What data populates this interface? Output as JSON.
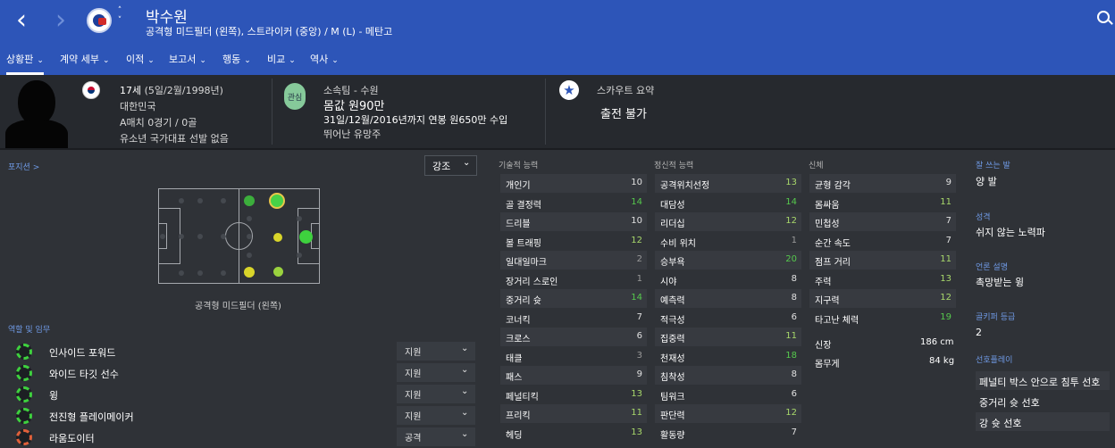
{
  "header": {
    "player_name": "박수원",
    "subtitle": "공격형 미드필더 (왼쪽), 스트라이커 (중앙) / M (L) - 메탄고"
  },
  "tabs": [
    {
      "label": "상황판"
    },
    {
      "label": "계약 세부"
    },
    {
      "label": "이적"
    },
    {
      "label": "보고서"
    },
    {
      "label": "행동"
    },
    {
      "label": "비교"
    },
    {
      "label": "역사"
    }
  ],
  "info": {
    "age": "17세",
    "dob": "(5일/2월/1998년)",
    "nation": "대한민국",
    "caps": "A매치 0경기 / 0골",
    "youth": "유소년 국가대표 선발 없음"
  },
  "club": {
    "badge": "관심",
    "team": "소속팀 - 수원",
    "value": "몸값 원90만",
    "contract": "31일/12월/2016년까지 연봉 원650만 수입",
    "potential": "뛰어난 유망주"
  },
  "scout": {
    "title": "스카우트 요약",
    "value": "출전 불가"
  },
  "position": {
    "link": "포지션 >",
    "emphasis": "강조",
    "label": "공격형 미드필더 (왼쪽)"
  },
  "roles": {
    "title": "역할 및 임무",
    "items": [
      {
        "name": "인사이드 포워드",
        "duty": "지원",
        "icon": "green"
      },
      {
        "name": "와이드 타깃 선수",
        "duty": "지원",
        "icon": "green"
      },
      {
        "name": "윙",
        "duty": "지원",
        "icon": "green"
      },
      {
        "name": "전진형 플레이메이커",
        "duty": "지원",
        "icon": "green"
      },
      {
        "name": "라움도이터",
        "duty": "공격",
        "icon": "orange"
      }
    ]
  },
  "columns": {
    "technical": "기술적 능력",
    "mental": "정신적 능력",
    "physical": "신체"
  },
  "technical": [
    {
      "name": "개인기",
      "value": "10",
      "c": "white"
    },
    {
      "name": "골 결정력",
      "value": "14",
      "c": "green"
    },
    {
      "name": "드리블",
      "value": "10",
      "c": "white"
    },
    {
      "name": "볼 트래핑",
      "value": "12",
      "c": "lgreen"
    },
    {
      "name": "일대일마크",
      "value": "2",
      "c": "grey"
    },
    {
      "name": "장거리 스로인",
      "value": "1",
      "c": "grey"
    },
    {
      "name": "중거리 슛",
      "value": "14",
      "c": "green"
    },
    {
      "name": "코너킥",
      "value": "7",
      "c": "white"
    },
    {
      "name": "크로스",
      "value": "6",
      "c": "white"
    },
    {
      "name": "태클",
      "value": "3",
      "c": "grey"
    },
    {
      "name": "패스",
      "value": "9",
      "c": "white"
    },
    {
      "name": "페널티킥",
      "value": "13",
      "c": "lgreen"
    },
    {
      "name": "프리킥",
      "value": "11",
      "c": "lgreen"
    },
    {
      "name": "헤딩",
      "value": "13",
      "c": "lgreen"
    }
  ],
  "mental": [
    {
      "name": "공격위치선정",
      "value": "13",
      "c": "lgreen"
    },
    {
      "name": "대담성",
      "value": "14",
      "c": "green"
    },
    {
      "name": "리더십",
      "value": "12",
      "c": "lgreen"
    },
    {
      "name": "수비 위치",
      "value": "1",
      "c": "grey"
    },
    {
      "name": "승부욕",
      "value": "20",
      "c": "green"
    },
    {
      "name": "시야",
      "value": "8",
      "c": "white"
    },
    {
      "name": "예측력",
      "value": "8",
      "c": "white"
    },
    {
      "name": "적극성",
      "value": "6",
      "c": "white"
    },
    {
      "name": "집중력",
      "value": "11",
      "c": "lgreen"
    },
    {
      "name": "천재성",
      "value": "18",
      "c": "green"
    },
    {
      "name": "침착성",
      "value": "8",
      "c": "white"
    },
    {
      "name": "팀워크",
      "value": "6",
      "c": "white"
    },
    {
      "name": "판단력",
      "value": "12",
      "c": "lgreen"
    },
    {
      "name": "활동량",
      "value": "7",
      "c": "white"
    }
  ],
  "physical": [
    {
      "name": "균형 감각",
      "value": "9",
      "c": "white"
    },
    {
      "name": "몸싸움",
      "value": "11",
      "c": "lgreen"
    },
    {
      "name": "민첩성",
      "value": "7",
      "c": "white"
    },
    {
      "name": "순간 속도",
      "value": "7",
      "c": "white"
    },
    {
      "name": "점프 거리",
      "value": "11",
      "c": "lgreen"
    },
    {
      "name": "주력",
      "value": "13",
      "c": "lgreen"
    },
    {
      "name": "지구력",
      "value": "12",
      "c": "lgreen"
    },
    {
      "name": "타고난 체력",
      "value": "19",
      "c": "green"
    }
  ],
  "body": {
    "height_label": "신장",
    "height": "186 cm",
    "weight_label": "몸무게",
    "weight": "84 kg"
  },
  "side": {
    "foot_label": "잘 쓰는 발",
    "foot": "양 발",
    "personality_label": "성격",
    "personality": "쉬지 않는 노력파",
    "media_label": "언론 설명",
    "media": "촉망받는 윙",
    "gk_label": "골키퍼 등급",
    "gk": "2",
    "prefs_label": "선호플레이",
    "prefs": [
      "페널티 박스 안으로 침투 선호",
      "중거리 슛 선호",
      "강 슛 선호"
    ]
  },
  "colors": {
    "header": "#2d55b8",
    "bg": "#2f3237",
    "accent": "#6f9ae6",
    "high": "#56c94d",
    "mid": "#a8d86b",
    "low": "#9a9a9a"
  }
}
